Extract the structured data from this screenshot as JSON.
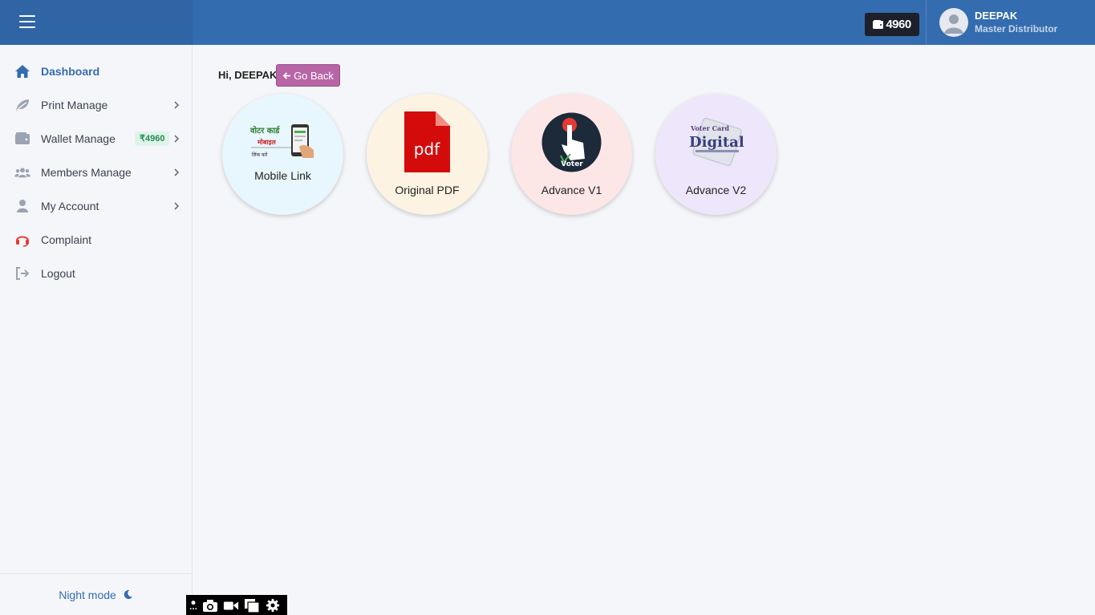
{
  "header": {
    "menu_icon": "hamburger-icon",
    "wallet_balance": "4960",
    "wallet_icon": "wallet-icon",
    "user": {
      "name": "DEEPAK",
      "role": "Master Distributor",
      "avatar_icon": "user-avatar-icon"
    }
  },
  "sidebar": {
    "items": [
      {
        "label": "Dashboard",
        "icon": "home-icon",
        "active": true
      },
      {
        "label": "Print Manage",
        "icon": "leaf-icon",
        "has_submenu": true
      },
      {
        "label": "Wallet Manage",
        "icon": "wallet-icon",
        "badge": "₹4960",
        "has_submenu": true
      },
      {
        "label": "Members Manage",
        "icon": "users-icon",
        "has_submenu": true
      },
      {
        "label": "My Account",
        "icon": "user-icon",
        "has_submenu": true
      },
      {
        "label": "Complaint",
        "icon": "headset-icon"
      },
      {
        "label": "Logout",
        "icon": "logout-icon"
      }
    ],
    "footer": {
      "label": "Night mode",
      "icon": "moon-icon"
    }
  },
  "main": {
    "greeting": "Hi, DEEPAK",
    "back_button": "Go Back",
    "tiles": [
      {
        "label": "Mobile Link",
        "bg": "#e8f6fd",
        "image_text": [
          "वोटर कार्ड",
          "मोबाइल",
          "लिंक करें"
        ]
      },
      {
        "label": "Original PDF",
        "bg": "#fdf3e3",
        "image_text": "pdf"
      },
      {
        "label": "Advance V1",
        "bg": "#fde6e6",
        "image_text": "Voter"
      },
      {
        "label": "Advance V2",
        "bg": "#eee6fb",
        "image_text": [
          "Voter Card",
          "Digital"
        ]
      }
    ]
  },
  "colors": {
    "primary": "#346cb0",
    "go_back": "#b765a6",
    "wallet_chip": "#1d1f2a"
  }
}
